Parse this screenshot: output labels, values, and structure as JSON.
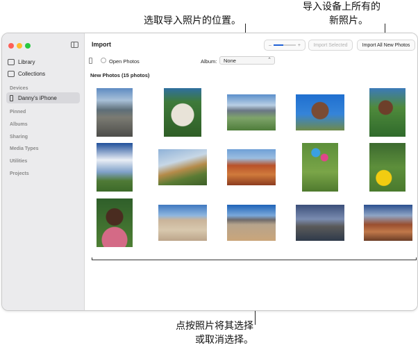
{
  "callouts": {
    "location": "选取导入照片的位置。",
    "import_all_line1": "导入设备上所有的",
    "import_all_line2": "新照片。",
    "select_line1": "点按照片将其选择",
    "select_line2": "或取消选择。"
  },
  "window": {
    "title": "Import",
    "import_selected_label": "Import Selected",
    "import_all_label": "Import All New Photos",
    "zoom_minus": "–",
    "zoom_plus": "+",
    "open_photos_label": "Open Photos",
    "album_label": "Album:",
    "album_value": "None",
    "photos_heading": "New Photos (15 photos)"
  },
  "sidebar": {
    "items": [
      {
        "label": "Library",
        "icon": "library-icon"
      },
      {
        "label": "Collections",
        "icon": "collections-icon"
      }
    ],
    "devices_header": "Devices",
    "device_name": "Danny's iPhone",
    "sections": [
      "Pinned",
      "Albums",
      "Sharing",
      "Media Types",
      "Utilities",
      "Projects"
    ]
  },
  "colors": {
    "close": "#fe5f57",
    "minimize": "#febc2e",
    "zoom": "#28c840",
    "accent": "#1e5fd6"
  }
}
